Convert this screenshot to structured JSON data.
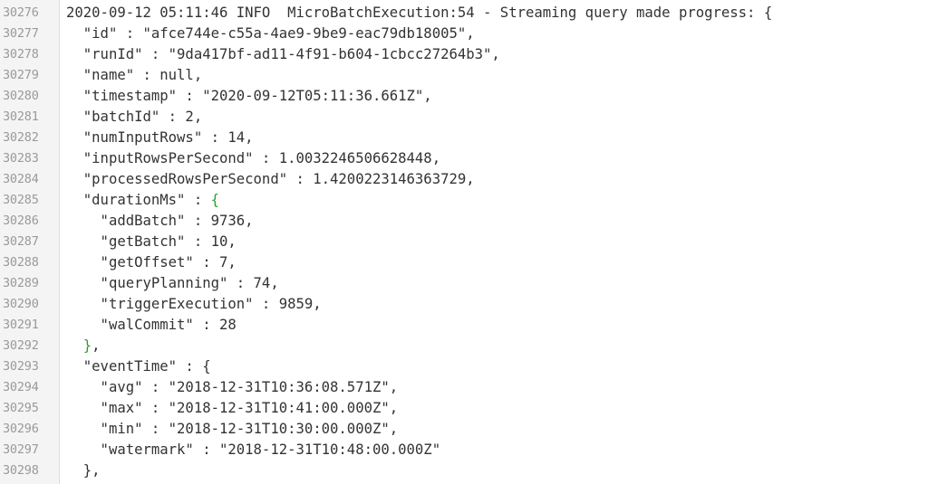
{
  "colors": {
    "text": "#333333",
    "line_number": "#9a9a9a",
    "gutter_bg": "#f4f4f4",
    "matched_brace": "#2fa02f"
  },
  "lines": [
    {
      "num": "30276",
      "text": "2020-09-12 05:11:46 INFO  MicroBatchExecution:54 - Streaming query made progress: {"
    },
    {
      "num": "30277",
      "text": "  \"id\" : \"afce744e-c55a-4ae9-9be9-eac79db18005\","
    },
    {
      "num": "30278",
      "text": "  \"runId\" : \"9da417bf-ad11-4f91-b604-1cbcc27264b3\","
    },
    {
      "num": "30279",
      "text": "  \"name\" : null,"
    },
    {
      "num": "30280",
      "text": "  \"timestamp\" : \"2020-09-12T05:11:36.661Z\","
    },
    {
      "num": "30281",
      "text": "  \"batchId\" : 2,"
    },
    {
      "num": "30282",
      "text": "  \"numInputRows\" : 14,"
    },
    {
      "num": "30283",
      "text": "  \"inputRowsPerSecond\" : 1.0032246506628448,"
    },
    {
      "num": "30284",
      "text": "  \"processedRowsPerSecond\" : 1.4200223146363729,"
    },
    {
      "num": "30285",
      "pre": "  \"durationMs\" : ",
      "brace": "{",
      "post": ""
    },
    {
      "num": "30286",
      "text": "    \"addBatch\" : 9736,"
    },
    {
      "num": "30287",
      "text": "    \"getBatch\" : 10,"
    },
    {
      "num": "30288",
      "text": "    \"getOffset\" : 7,"
    },
    {
      "num": "30289",
      "text": "    \"queryPlanning\" : 74,"
    },
    {
      "num": "30290",
      "text": "    \"triggerExecution\" : 9859,"
    },
    {
      "num": "30291",
      "text": "    \"walCommit\" : 28"
    },
    {
      "num": "30292",
      "pre": "  ",
      "brace": "}",
      "post": ","
    },
    {
      "num": "30293",
      "text": "  \"eventTime\" : {"
    },
    {
      "num": "30294",
      "text": "    \"avg\" : \"2018-12-31T10:36:08.571Z\","
    },
    {
      "num": "30295",
      "text": "    \"max\" : \"2018-12-31T10:41:00.000Z\","
    },
    {
      "num": "30296",
      "text": "    \"min\" : \"2018-12-31T10:30:00.000Z\","
    },
    {
      "num": "30297",
      "text": "    \"watermark\" : \"2018-12-31T10:48:00.000Z\""
    },
    {
      "num": "30298",
      "text": "  },"
    }
  ]
}
